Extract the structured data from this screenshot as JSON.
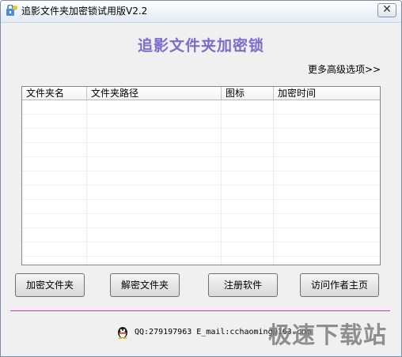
{
  "window": {
    "title": "追影文件夹加密锁试用版V2.2",
    "close_glyph": "✕"
  },
  "main": {
    "heading": "追影文件夹加密锁",
    "more_options": "更多高级选项>>",
    "table": {
      "columns": [
        "文件夹名",
        "文件夹路径",
        "图标",
        "加密时间"
      ],
      "rows": []
    },
    "buttons": {
      "encrypt": "加密文件夹",
      "decrypt": "解密文件夹",
      "register": "注册软件",
      "visit": "访问作者主页"
    },
    "contact": "QQ:279197963 E_mail:cchaoming@163.com",
    "watermark": "极速下载站"
  },
  "colors": {
    "heading": "#7a6dcc",
    "separator": "#d9379b"
  },
  "icons": {
    "app": "folder-lock-app-icon",
    "qq": "qq-penguin-icon",
    "close": "close-icon"
  }
}
